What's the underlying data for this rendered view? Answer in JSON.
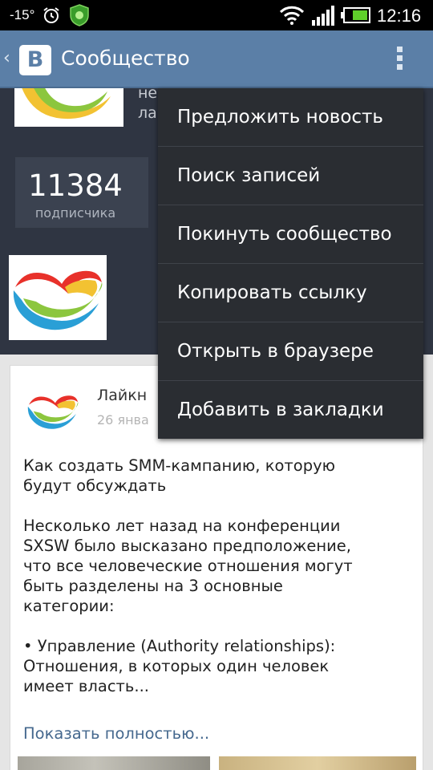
{
  "status_bar": {
    "temperature": "-15°",
    "time": "12:16"
  },
  "action_bar": {
    "logo_letter": "B",
    "title": "Сообщество"
  },
  "community": {
    "name_partial_lines": [
      "не",
      "ла"
    ],
    "subscribers_count": "11384",
    "subscribers_label": "подписчика"
  },
  "post": {
    "author_partial": "Лайкн",
    "date_partial": "26 янва",
    "text": "Как создать SMM-кампанию, которую\nбудут обсуждать\n\nНесколько лет назад на конференции\nSXSW было высказано предположение,\nчто все человеческие отношения могут\nбыть разделены на 3 основные\nкатегории:\n\n• Управление (Authority relationships):\nОтношения, в которых один человек\nимеет власть...",
    "show_more": "Показать полностью..."
  },
  "menu": {
    "items": [
      {
        "label": "Предложить новость"
      },
      {
        "label": "Поиск записей"
      },
      {
        "label": "Покинуть сообщество"
      },
      {
        "label": "Копировать ссылку"
      },
      {
        "label": "Открыть в браузере"
      },
      {
        "label": "Добавить в закладки"
      }
    ]
  },
  "colors": {
    "action_bar": "#5b7fa7",
    "header_bg": "#2f3542",
    "menu_bg": "#2a2d32",
    "link": "#45688e"
  }
}
